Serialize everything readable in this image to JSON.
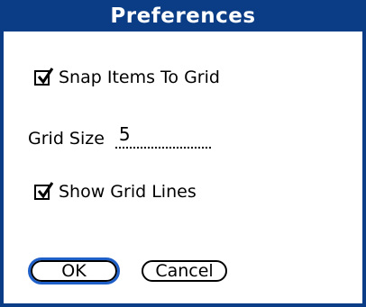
{
  "window": {
    "title": "Preferences"
  },
  "options": {
    "snap_to_grid": {
      "label": "Snap Items To Grid",
      "checked": true
    },
    "grid_size": {
      "label": "Grid Size",
      "value": "5"
    },
    "show_grid_lines": {
      "label": "Show Grid Lines",
      "checked": true
    }
  },
  "buttons": {
    "ok_label": "OK",
    "cancel_label": "Cancel"
  },
  "colors": {
    "accent": "#0b3d86",
    "focus_ring": "#1e5fc8"
  },
  "icons": {
    "checkbox_checked": "checkbox-checked-icon"
  }
}
